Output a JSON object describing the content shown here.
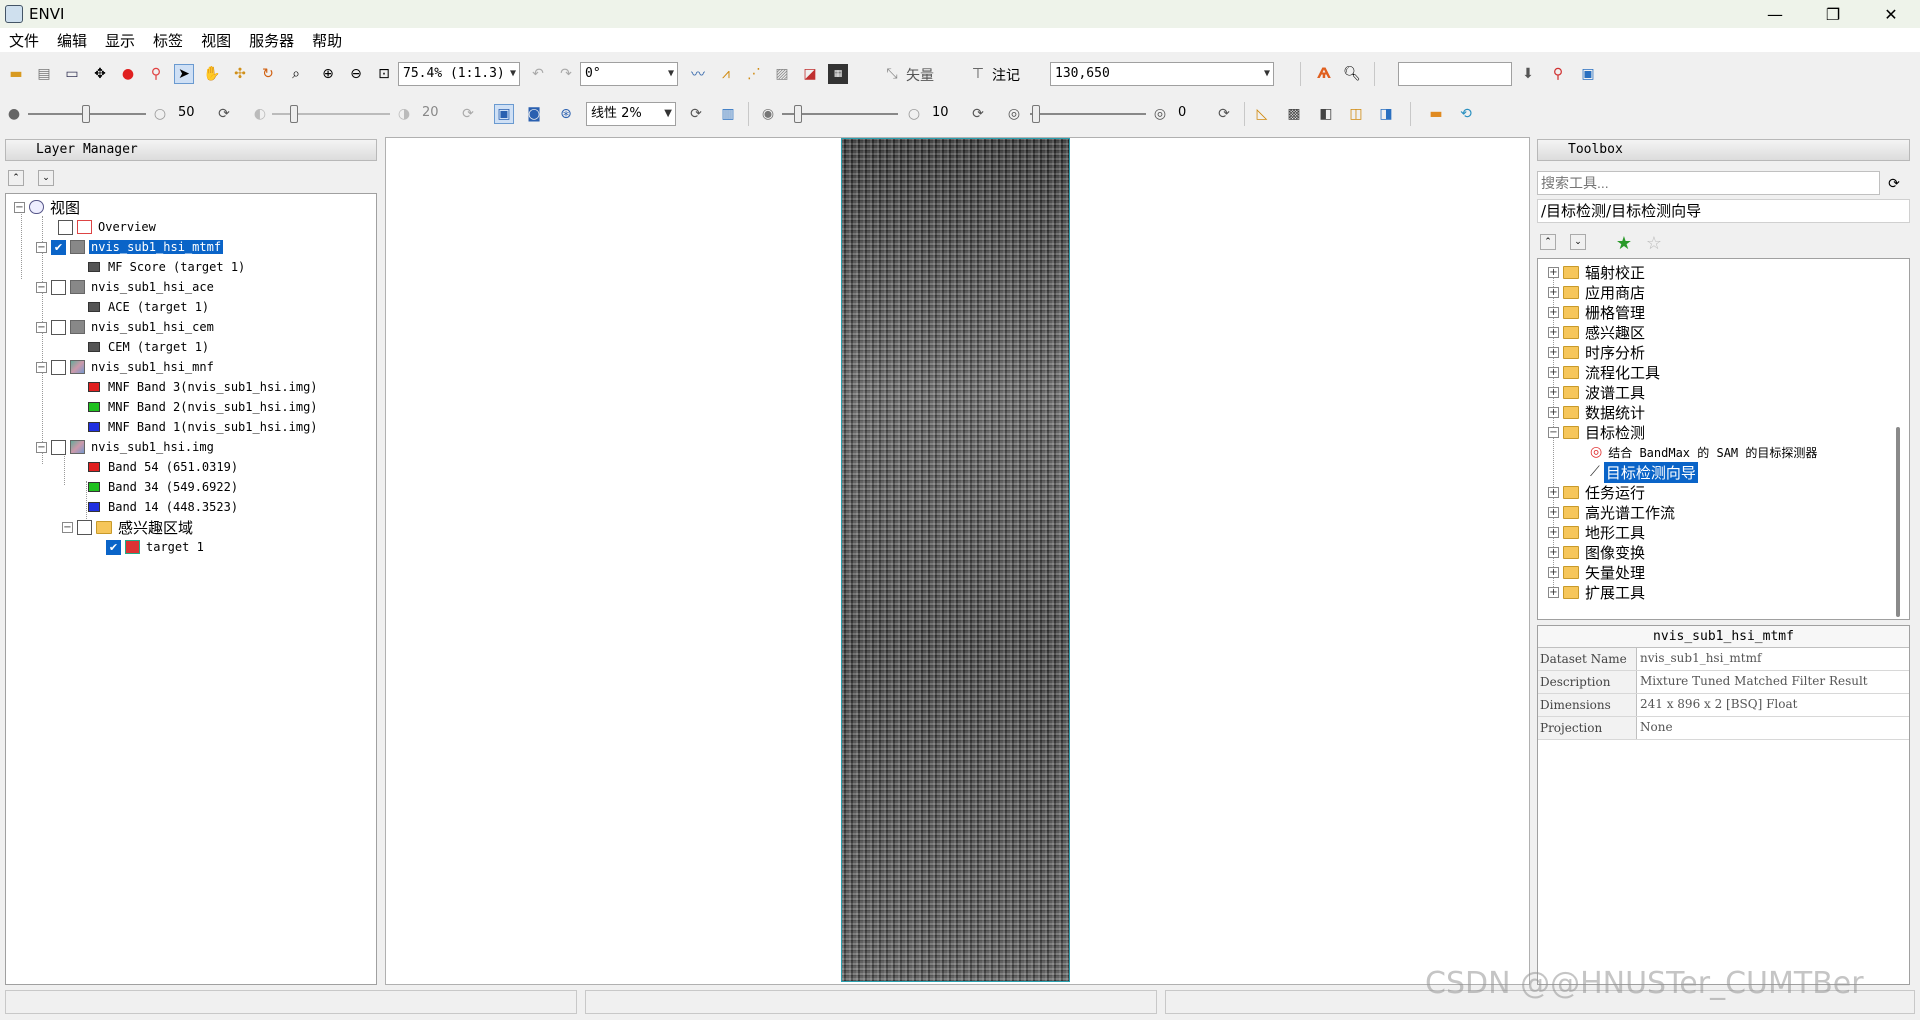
{
  "window": {
    "title": "ENVI",
    "min": "—",
    "max": "❐",
    "close": "✕"
  },
  "menu": [
    "文件",
    "编辑",
    "显示",
    "标签",
    "视图",
    "服务器",
    "帮助"
  ],
  "toolbar1": {
    "zoom": "75.4% (1:1.3)",
    "rotation": "0°",
    "vector_label": "矢量",
    "annotation_label": "注记",
    "location": "130,650",
    "search_value": ""
  },
  "toolbar2": {
    "brightness": "50",
    "contrast": "20",
    "stretch": "线性 2%",
    "sharpen": "10",
    "transparency": "0"
  },
  "layer_manager": {
    "title": "Layer Manager",
    "root": "视图",
    "items": [
      {
        "label": "Overview"
      },
      {
        "label": "nvis_sub1_hsi_mtmf",
        "checked": true,
        "selected": true,
        "children": [
          "MF Score (target 1)"
        ]
      },
      {
        "label": "nvis_sub1_hsi_ace",
        "children": [
          "ACE (target 1)"
        ]
      },
      {
        "label": "nvis_sub1_hsi_cem",
        "children": [
          "CEM (target 1)"
        ]
      },
      {
        "label": "nvis_sub1_hsi_mnf",
        "children": [
          "MNF Band 3(nvis_sub1_hsi.img)",
          "MNF Band 2(nvis_sub1_hsi.img)",
          "MNF Band 1(nvis_sub1_hsi.img)"
        ]
      },
      {
        "label": "nvis_sub1_hsi.img",
        "children": [
          "Band 54 (651.0319)",
          "Band 34 (549.6922)",
          "Band 14 (448.3523)"
        ]
      }
    ],
    "roi_folder": "感兴趣区域",
    "roi_item": "target 1"
  },
  "toolbox": {
    "title": "Toolbox",
    "search_placeholder": "搜索工具...",
    "path": "/目标检测/目标检测向导",
    "folders": [
      "辐射校正",
      "应用商店",
      "栅格管理",
      "感兴趣区",
      "时序分析",
      "流程化工具",
      "波谱工具",
      "数据统计",
      "目标检测",
      "任务运行",
      "高光谱工作流",
      "地形工具",
      "图像变换",
      "矢量处理",
      "扩展工具"
    ],
    "target_children": [
      "结合 BandMax 的 SAM 的目标探测器",
      "目标检测向导"
    ]
  },
  "metadata": {
    "title": "nvis_sub1_hsi_mtmf",
    "rows": [
      {
        "key": "Dataset Name",
        "value": "nvis_sub1_hsi_mtmf"
      },
      {
        "key": "Description",
        "value": "Mixture Tuned Matched Filter Result"
      },
      {
        "key": "Dimensions",
        "value": "241 x 896 x 2 [BSQ] Float"
      },
      {
        "key": "Projection",
        "value": "None"
      }
    ]
  },
  "watermark": "CSDN @@HNUSTer_CUMTBer",
  "colors": {
    "selection": "#0a64c8",
    "raster_border": "#2aa0b0"
  }
}
